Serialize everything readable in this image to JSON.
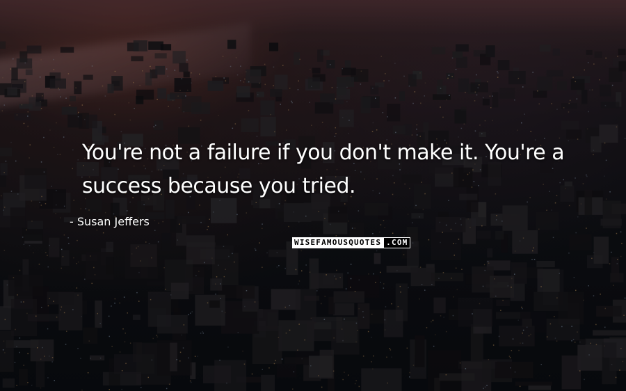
{
  "quote": {
    "text": "You're not a failure if you don't make it. You're a success because you tried.",
    "author": "- Susan Jeffers"
  },
  "watermark": {
    "part1": "WISEFAMOUSQUOTES",
    "part2": ".COM"
  },
  "background": {
    "description_icon": "city-skyline-image",
    "accent_sky": "#3a2a2c",
    "base": "#0b0d12"
  }
}
